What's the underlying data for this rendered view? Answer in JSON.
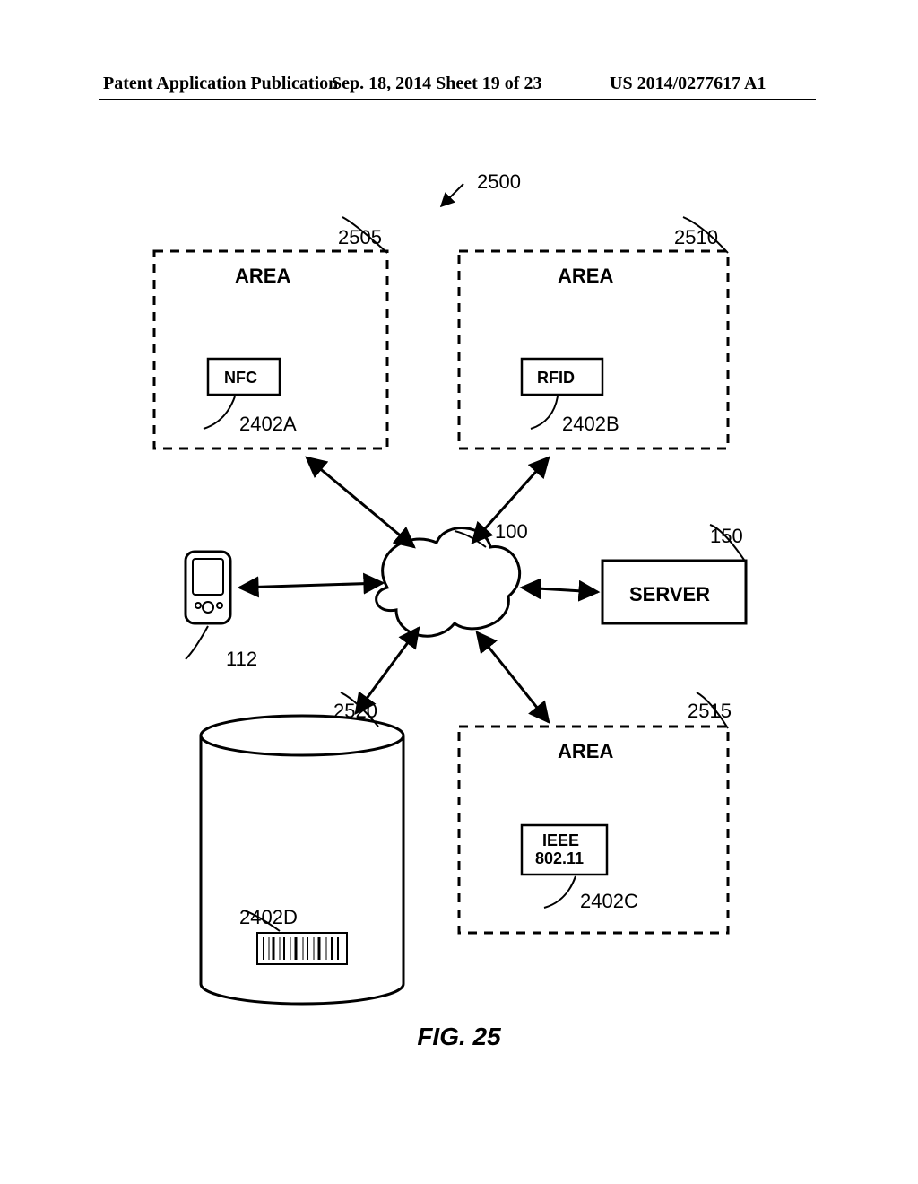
{
  "header": {
    "left": "Patent Application Publication",
    "center": "Sep. 18, 2014  Sheet 19 of 23",
    "right": "US 2014/0277617 A1"
  },
  "fig_caption": "FIG. 25",
  "refs": {
    "sys": "2500",
    "area_a": "2505",
    "area_b": "2510",
    "area_c": "2515",
    "tank": "2520",
    "nfc": "2402A",
    "rfid": "2402B",
    "wlan": "2402C",
    "barcode": "2402D",
    "cloud": "100",
    "server": "150",
    "phone": "112"
  },
  "labels": {
    "area": "AREA",
    "nfc": "NFC",
    "rfid": "RFID",
    "wlan1": "IEEE",
    "wlan2": "802.11",
    "server": "SERVER"
  }
}
